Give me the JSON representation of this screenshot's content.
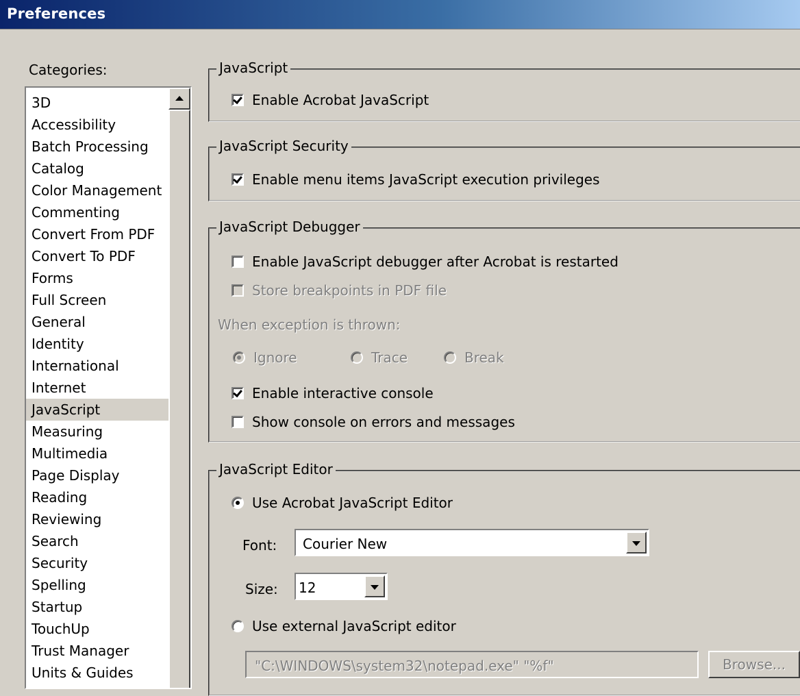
{
  "window": {
    "title": "Preferences"
  },
  "categories": {
    "label": "Categories:",
    "selected": "JavaScript",
    "items": [
      "3D",
      "Accessibility",
      "Batch Processing",
      "Catalog",
      "Color Management",
      "Commenting",
      "Convert From PDF",
      "Convert To PDF",
      "Forms",
      "Full Screen",
      "General",
      "Identity",
      "International",
      "Internet",
      "JavaScript",
      "Measuring",
      "Multimedia",
      "Page Display",
      "Reading",
      "Reviewing",
      "Search",
      "Security",
      "Spelling",
      "Startup",
      "TouchUp",
      "Trust Manager",
      "Units & Guides"
    ]
  },
  "javascript": {
    "title": "JavaScript",
    "enable_acrobat_js": {
      "label": "Enable Acrobat JavaScript",
      "checked": true
    }
  },
  "security": {
    "title": "JavaScript Security",
    "enable_menu_privileges": {
      "label": "Enable menu items JavaScript execution privileges",
      "checked": true
    }
  },
  "debugger": {
    "title": "JavaScript Debugger",
    "enable_debugger": {
      "label": "Enable JavaScript debugger after Acrobat is restarted",
      "checked": false
    },
    "store_breakpoints": {
      "label": "Store breakpoints in PDF file",
      "checked": false,
      "disabled": true
    },
    "exception_label": "When exception is thrown:",
    "exception_options": [
      {
        "label": "Ignore",
        "selected": true
      },
      {
        "label": "Trace",
        "selected": false
      },
      {
        "label": "Break",
        "selected": false
      }
    ],
    "interactive_console": {
      "label": "Enable interactive console",
      "checked": true
    },
    "show_console": {
      "label": "Show console on errors and messages",
      "checked": false
    }
  },
  "editor": {
    "title": "JavaScript Editor",
    "use_acrobat_editor": {
      "label": "Use Acrobat JavaScript Editor",
      "selected": true
    },
    "font_label": "Font:",
    "font_value": "Courier New",
    "size_label": "Size:",
    "size_value": "12",
    "use_external_editor": {
      "label": "Use external JavaScript editor",
      "selected": false
    },
    "external_path": "\"C:\\WINDOWS\\system32\\notepad.exe\" \"%f\"",
    "browse_label": "Browse..."
  }
}
